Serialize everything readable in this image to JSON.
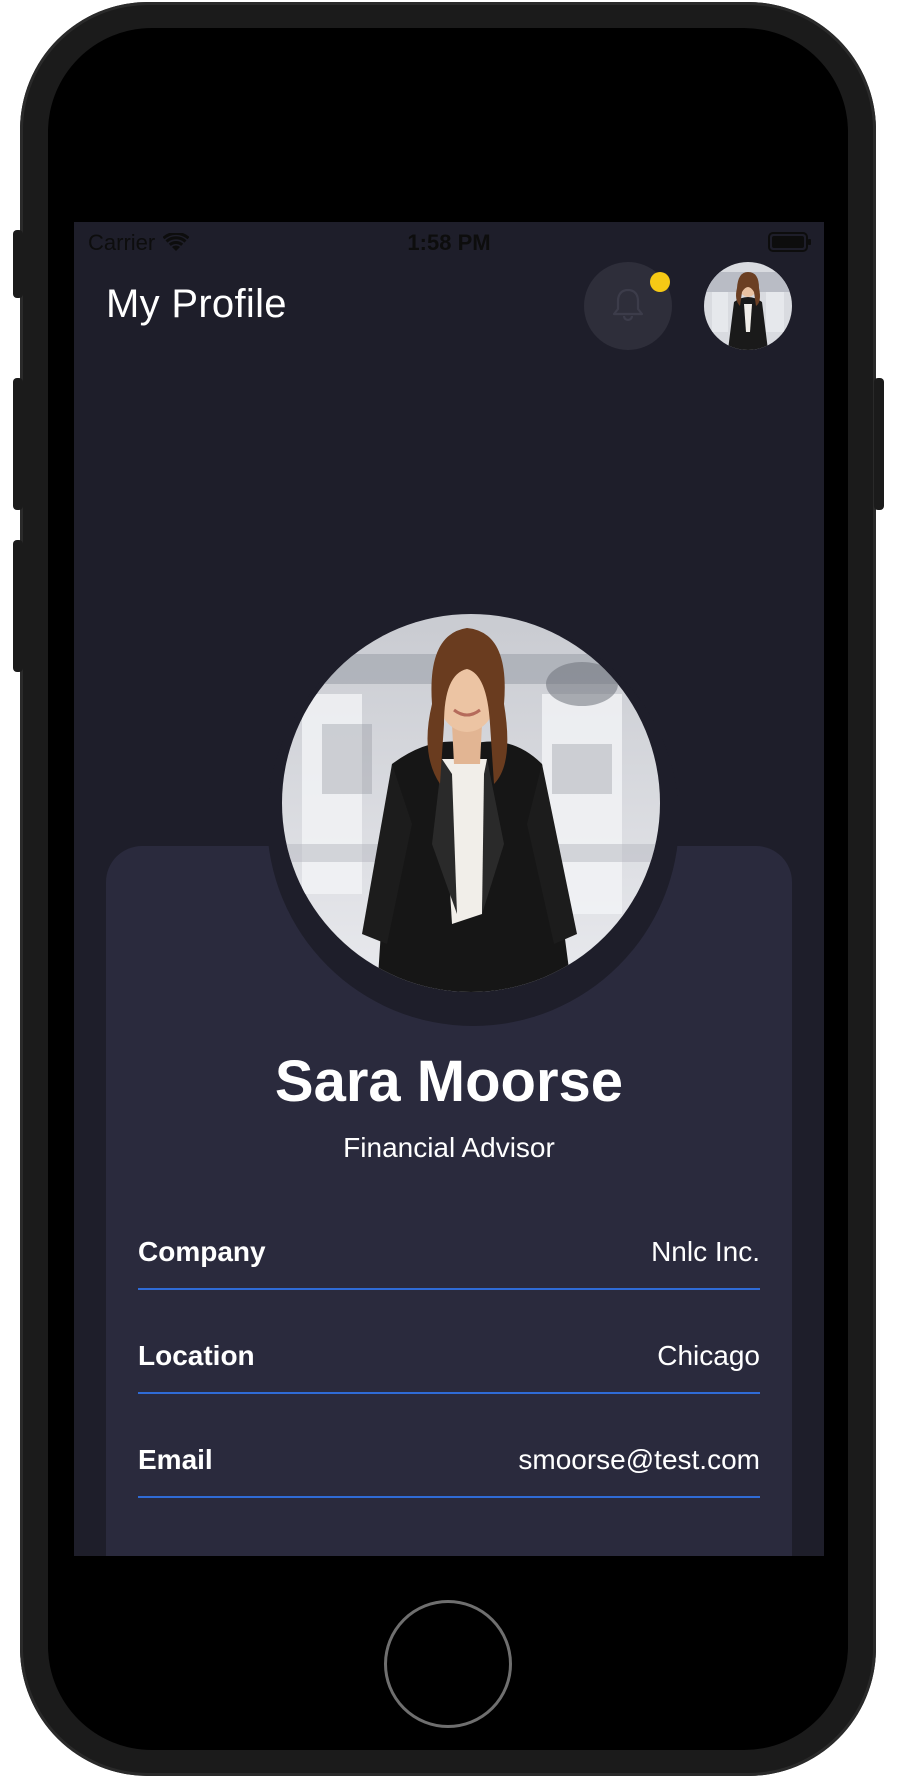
{
  "status_bar": {
    "carrier": "Carrier",
    "time": "1:58 PM"
  },
  "header": {
    "title": "My Profile",
    "notification_dot_color": "#f6c915",
    "icons": [
      "bell-icon",
      "avatar"
    ]
  },
  "profile": {
    "name": "Sara Moorse",
    "role": "Financial Advisor",
    "fields": [
      {
        "label": "Company",
        "value": "Nnlc Inc."
      },
      {
        "label": "Location",
        "value": "Chicago"
      },
      {
        "label": "Email",
        "value": "smoorse@test.com"
      }
    ]
  },
  "colors": {
    "background": "#1e1e2a",
    "card": "#2a2a3d",
    "divider": "#2f6bd6",
    "accent_dot": "#f6c915"
  }
}
